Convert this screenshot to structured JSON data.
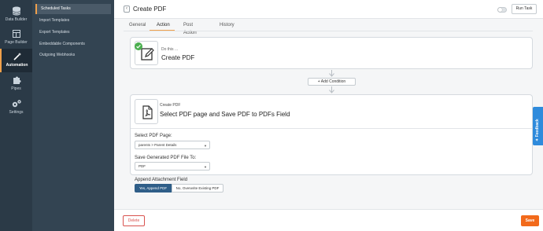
{
  "rail": {
    "items": [
      {
        "label": "Data Builder",
        "icon": "database-icon"
      },
      {
        "label": "Page Builder",
        "icon": "layout-icon"
      },
      {
        "label": "Automation",
        "icon": "magic-wand-icon"
      },
      {
        "label": "Pipes",
        "icon": "puzzle-icon"
      },
      {
        "label": "Settings",
        "icon": "gears-icon"
      }
    ],
    "active": "Automation"
  },
  "subnav": {
    "items": [
      {
        "label": "Scheduled Tasks"
      },
      {
        "label": "Import Templates"
      },
      {
        "label": "Export Templates"
      },
      {
        "label": "Embeddable Components"
      },
      {
        "label": "Outgoing Webhooks"
      }
    ],
    "active": "Scheduled Tasks"
  },
  "header": {
    "back_icon": "chevron-left-icon",
    "title": "Create PDF",
    "run_task_label": "Run Task"
  },
  "tabs": [
    {
      "label": "General"
    },
    {
      "label": "Action"
    },
    {
      "label": "Post Action"
    },
    {
      "label": "History"
    }
  ],
  "active_tab": "Action",
  "trigger_card": {
    "eyebrow": "Do this ...",
    "title": "Create PDF"
  },
  "add_condition_label": "+ Add Condition",
  "action_card": {
    "eyebrow": "Create PDF",
    "title": "Select PDF page and Save PDF to PDFs Field",
    "select_page": {
      "label": "Select PDF Page:",
      "value": "parents > Parent Details"
    },
    "save_to": {
      "label": "Save Generated PDF File To:",
      "value": "PDF"
    },
    "append": {
      "label": "Append Attachment Field",
      "options": [
        "Yes, Append PDF",
        "No, Overwrite Existing PDF"
      ],
      "selected": "Yes, Append PDF"
    }
  },
  "footer": {
    "delete_label": "Delete",
    "save_label": "Save"
  },
  "feedback_label": "Feedback",
  "colors": {
    "accent": "#f0a04b",
    "save": "#f26a1b",
    "delete": "#d9534f",
    "selected_segment": "#2f5e88",
    "feedback": "#2f8bdc",
    "rail_bg": "#2b3a47",
    "subnav_bg": "#334452"
  }
}
